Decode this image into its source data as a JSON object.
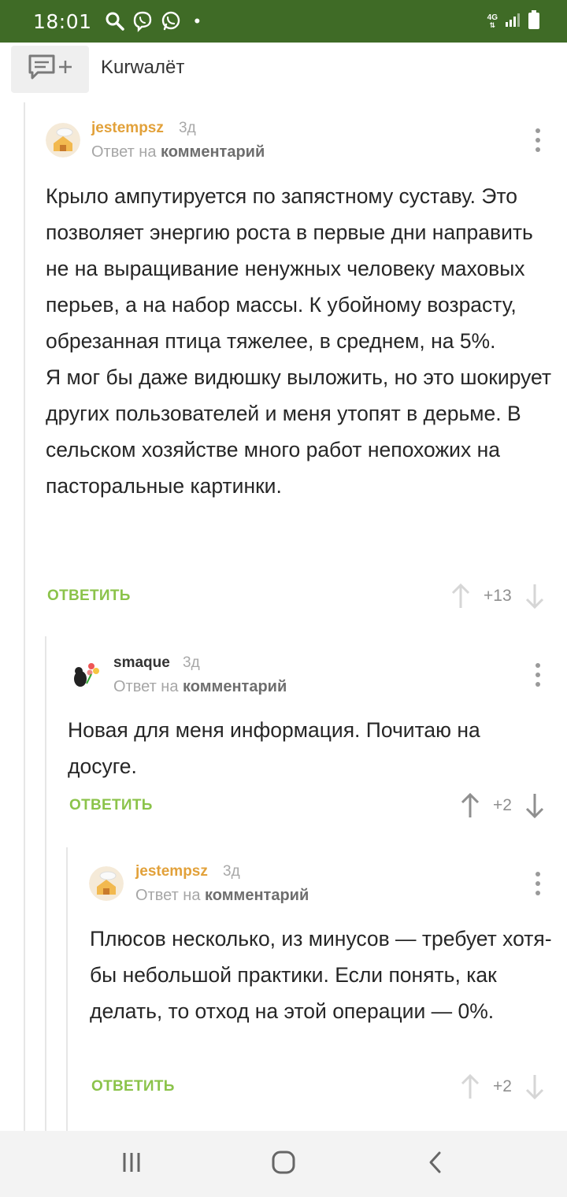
{
  "status_bar": {
    "time": "18:01",
    "dot": "•",
    "network": "4G",
    "icons": [
      "search-icon",
      "viber-icon",
      "whatsapp-icon",
      "signal-icon",
      "battery-icon"
    ]
  },
  "header": {
    "post_title": "Kurwалёт",
    "comment_icon": "comment-add-icon"
  },
  "comments": [
    {
      "author": "jestempsz",
      "time": "3д",
      "reply_prefix": "Ответ на",
      "reply_target": "комментарий",
      "text": "Крыло ампутируется по запястному суставу. Это позволяет энергию роста в первые дни направить не на выращивание ненужных человеку маховых перьев, а на набор массы. К убойному возрасту, обрезанная птица тяжелее, в среднем, на 5%.\n Я мог бы даже видюшку выложить, но это шокирует других пользователей и меня утопят в дерьме. В сельском хозяйстве много работ непохожих на пасторальные картинки.",
      "reply_label": "ОТВЕТИТЬ",
      "rating": "+13"
    },
    {
      "author": "smaque",
      "time": "3д",
      "reply_prefix": "Ответ на",
      "reply_target": "комментарий",
      "text": "Новая для меня информация. Почитаю на досуге.",
      "reply_label": "ОТВЕТИТЬ",
      "rating": "+2"
    },
    {
      "author": "jestempsz",
      "time": "3д",
      "reply_prefix": "Ответ на",
      "reply_target": "комментарий",
      "text": "Плюсов несколько, из минусов — требует хотя-бы небольшой практики. Если понять, как делать, то отход на этой операции — 0%.",
      "reply_label": "ОТВЕТИТЬ",
      "rating": "+2"
    }
  ],
  "nav_bar": {
    "icons": [
      "recent-apps-icon",
      "home-icon",
      "back-icon"
    ]
  },
  "colors": {
    "status_bar": "#3f6b26",
    "accent_green": "#8bc34a",
    "author_orange": "#e2a13a"
  }
}
